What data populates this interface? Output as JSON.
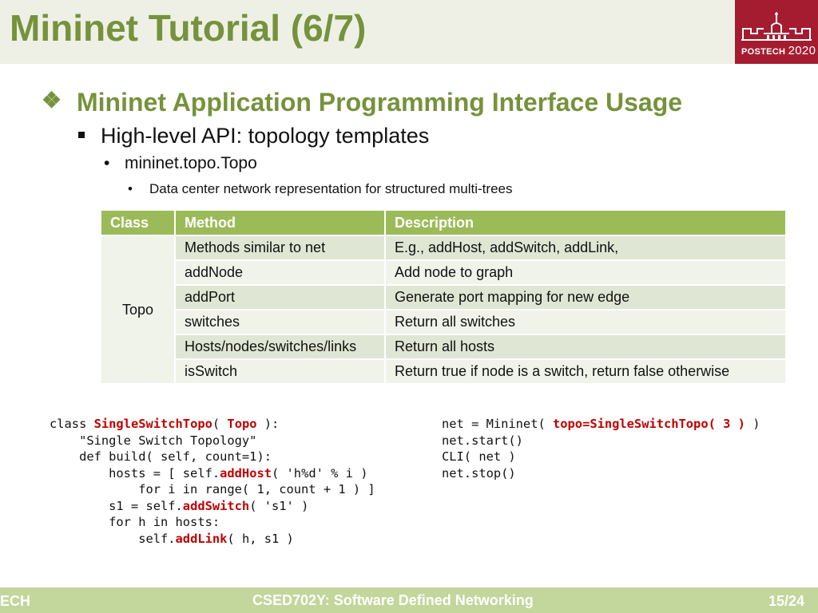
{
  "header": {
    "title": "Mininet Tutorial (6/7)",
    "logo_brand": "POSTECH",
    "logo_year": "2020"
  },
  "bullets": {
    "level1": "Mininet Application Programming Interface Usage",
    "level2": "High-level API: topology templates",
    "level3": "mininet.topo.Topo",
    "level4": "Data center network representation for structured multi-trees"
  },
  "table": {
    "headers": [
      "Class",
      "Method",
      "Description"
    ],
    "class_value": "Topo",
    "rows": [
      {
        "method": "Methods similar to net",
        "description": "E.g., addHost, addSwitch, addLink,"
      },
      {
        "method": "addNode",
        "description": "Add node to graph"
      },
      {
        "method": "addPort",
        "description": "Generate port mapping for new edge"
      },
      {
        "method": "switches",
        "description": "Return all switches"
      },
      {
        "method": "Hosts/nodes/switches/links",
        "description": "Return all hosts"
      },
      {
        "method": "isSwitch",
        "description": "Return true if node is a switch, return false otherwise"
      }
    ]
  },
  "code_left": {
    "l1a": "class ",
    "l1b": "SingleSwitchTopo",
    "l1c": "( ",
    "l1d": "Topo",
    "l1e": " ):",
    "l2": "    \"Single Switch Topology\"",
    "l3": "    def build( self, count=1):",
    "l4a": "        hosts = [ self.",
    "l4b": "addHost",
    "l4c": "( 'h%d' % i )",
    "l5": "            for i in range( 1, count + 1 ) ]",
    "l6a": "        s1 = self.",
    "l6b": "addSwitch",
    "l6c": "( 's1' )",
    "l7": "        for h in hosts:",
    "l8a": "            self.",
    "l8b": "addLink",
    "l8c": "( h, s1 )"
  },
  "code_right": {
    "l1a": "net = Mininet( ",
    "l1b": "topo=SingleSwitchTopo( 3 )",
    "l1c": " )",
    "l2": "net.start()",
    "l3": "CLI( net )",
    "l4": "net.stop()"
  },
  "footer": {
    "left": "ECH",
    "center": "CSED702Y: Software Defined Networking",
    "page": "15/24"
  },
  "colors": {
    "title_green": "#76923c",
    "table_header": "#9bbb59",
    "code_highlight": "#c00000",
    "footer_bar": "#c3d69b",
    "logo_bg": "#a51c30"
  }
}
